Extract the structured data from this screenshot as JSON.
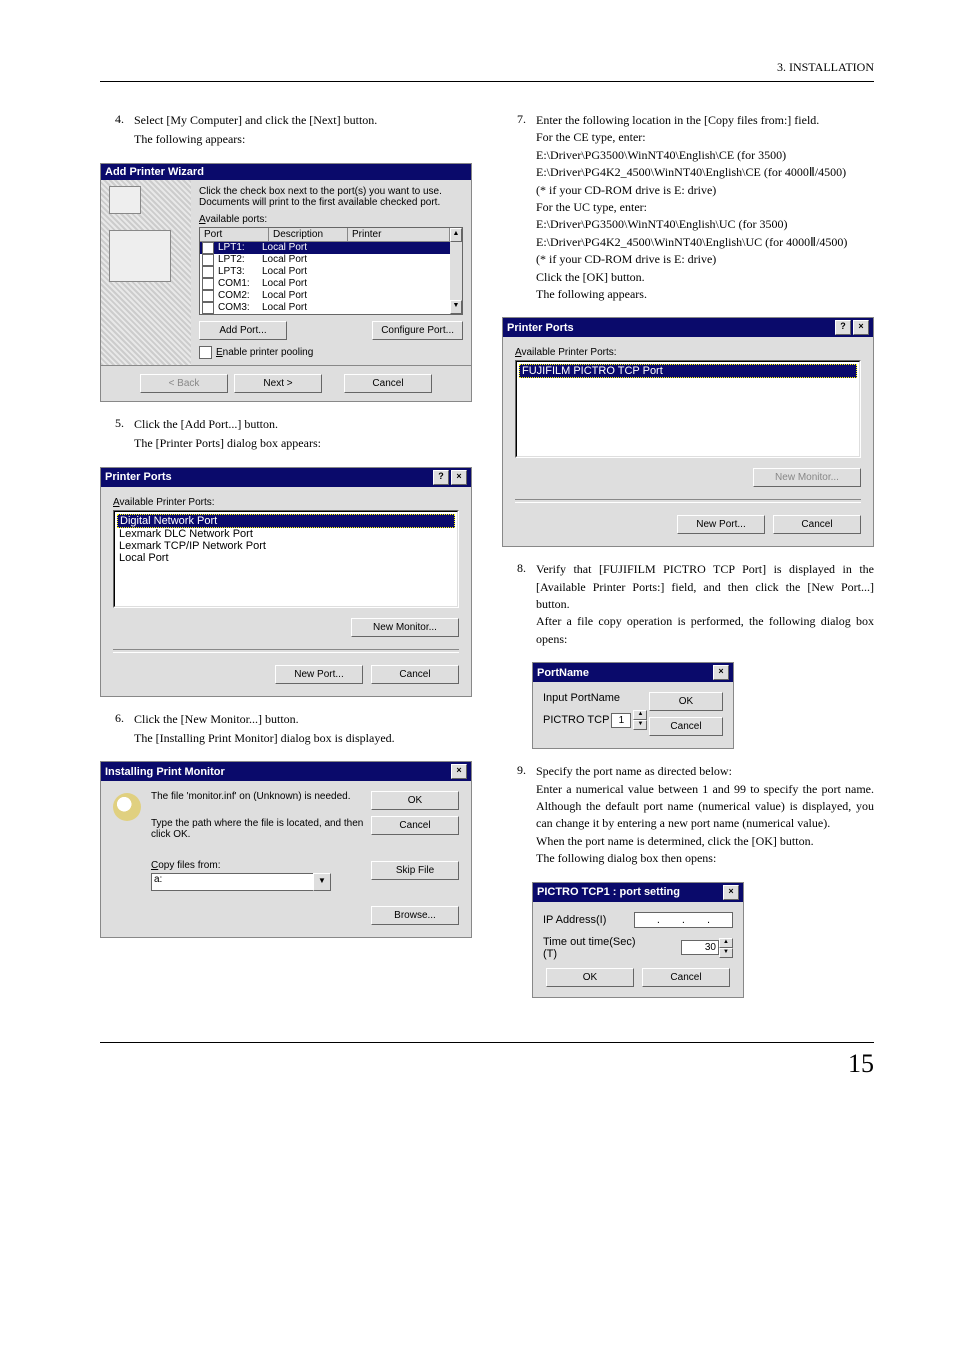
{
  "header": {
    "section": "3. INSTALLATION"
  },
  "page_number": "15",
  "left": {
    "step4": {
      "text_a": "Select ",
      "my_computer": "[My Computer]",
      "text_b": " and click the ",
      "next_btn": "[Next]",
      "text_c": " button.",
      "sub": "The following appears:"
    },
    "apw": {
      "title": "Add Printer Wizard",
      "intro": "Click the check box next to the port(s) you want to use. Documents will print to the first available checked port.",
      "avail_label": "Available ports:",
      "head_port": "Port",
      "head_desc": "Description",
      "head_printer": "Printer",
      "rows": [
        {
          "port": "LPT1:",
          "desc": "Local Port",
          "sel": true
        },
        {
          "port": "LPT2:",
          "desc": "Local Port"
        },
        {
          "port": "LPT3:",
          "desc": "Local Port"
        },
        {
          "port": "COM1:",
          "desc": "Local Port"
        },
        {
          "port": "COM2:",
          "desc": "Local Port"
        },
        {
          "port": "COM3:",
          "desc": "Local Port"
        }
      ],
      "add_port_btn": "Add Port...",
      "configure_port_btn": "Configure Port...",
      "enable_pooling": "Enable printer pooling",
      "back_btn": "< Back",
      "next_btn": "Next >",
      "cancel_btn": "Cancel"
    },
    "step5": {
      "text_a": "Click the ",
      "add_port": "[Add Port...]",
      "text_b": " button.",
      "sub_a": "The ",
      "sub_b": "[Printer Ports]",
      "sub_c": " dialog box appears:"
    },
    "printer_ports_left": {
      "title": "Printer Ports",
      "avail_label": "Available Printer Ports:",
      "items": [
        "Digital Network Port",
        "Lexmark DLC Network Port",
        "Lexmark TCP/IP Network Port",
        "Local Port"
      ],
      "new_monitor_btn": "New Monitor...",
      "new_port_btn": "New Port...",
      "cancel_btn": "Cancel"
    },
    "step6": {
      "text_a": "Click the ",
      "new_monitor": "[New Monitor...]",
      "text_b": " button.",
      "sub_a": "The ",
      "sub_b": "[Installing Print Monitor]",
      "sub_c": " dialog box is displayed."
    },
    "ipm": {
      "title": "Installing Print Monitor",
      "msg": "The file 'monitor.inf' on (Unknown) is needed.",
      "instruction": "Type the path where the file is located, and then click OK.",
      "copy_from_label": "Copy files from:",
      "combo_value": "a:",
      "ok_btn": "OK",
      "cancel_btn": "Cancel",
      "skip_btn": "Skip File",
      "browse_btn": "Browse..."
    }
  },
  "right": {
    "step7": {
      "line1_a": "Enter the following location in the ",
      "line1_b": "[Copy files from:]",
      "line1_c": " field.",
      "ce_intro": "For the CE type, enter:",
      "ce_path1": "E:\\Driver\\PG3500\\WinNT40\\English\\CE (for 3500)",
      "ce_path2": "E:\\Driver\\PG4K2_4500\\WinNT40\\English\\CE (for 4000Ⅱ/4500)",
      "note1": "(* if your CD-ROM drive is E: drive)",
      "uc_intro": "For the UC type, enter:",
      "uc_path1": "E:\\Driver\\PG3500\\WinNT40\\English\\UC  (for 3500)",
      "uc_path2": "E:\\Driver\\PG4K2_4500\\WinNT40\\English\\UC (for 4000Ⅱ/4500)",
      "note2": "(* if your CD-ROM drive is E: drive)",
      "click_ok_a": "Click the ",
      "click_ok_b": "[OK]",
      "click_ok_c": " button.",
      "following": "The following appears."
    },
    "printer_ports_right": {
      "title": "Printer Ports",
      "avail_label": "Available Printer Ports:",
      "items": [
        "FUJIFILM PICTRO TCP Port"
      ],
      "new_monitor_btn": "New Monitor...",
      "new_port_btn": "New Port...",
      "cancel_btn": "Cancel"
    },
    "step8": {
      "text_a": "Verify that ",
      "text_b": "[FUJIFILM PICTRO TCP Port]",
      "text_c": " is displayed in the ",
      "text_d": "[Available Printer Ports:]",
      "text_e": " field, and then click the ",
      "text_f": "[New Port...]",
      "text_g": " button.",
      "sub": " After a file copy operation is performed, the following dialog box opens:"
    },
    "portname": {
      "title": "PortName",
      "label1": "Input PortName",
      "label2": "PICTRO TCP",
      "value": "1",
      "ok_btn": "OK",
      "cancel_btn": "Cancel"
    },
    "step9": {
      "intro": "Specify the port name as directed below:",
      "body": "Enter a numerical value between 1 and 99 to specify the port name.  Although the default port name (numerical value) is displayed, you can change it by entering a new port name (numerical value).",
      "det_a": "When the port name is determined, click the ",
      "det_b": "[OK]",
      "det_c": " button.",
      "following": "The following dialog box then opens:"
    },
    "portsetting": {
      "title": "PICTRO TCP1 : port setting",
      "ip_label": "IP Address(I)",
      "timeout_label": "Time out time(Sec)(T)",
      "timeout_value": "30",
      "ok_btn": "OK",
      "cancel_btn": "Cancel"
    }
  }
}
